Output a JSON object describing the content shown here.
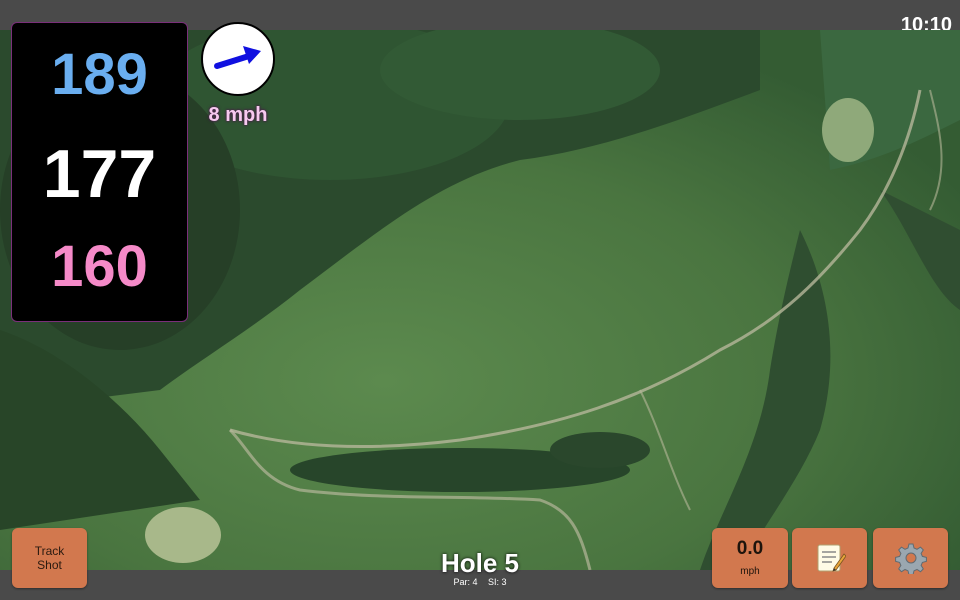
{
  "status_bar": {
    "time": "10:10"
  },
  "distances": {
    "back": "189",
    "middle": "177",
    "front": "160"
  },
  "wind": {
    "speed": "8 mph",
    "direction_icon": "wind-arrow-icon"
  },
  "hole": {
    "title": "Hole 5",
    "par": "Par: 4",
    "stroke_index": "SI: 3"
  },
  "buttons": {
    "track_shot_line1": "Track",
    "track_shot_line2": "Shot",
    "speed_value": "0.0",
    "speed_unit": "mph",
    "notes_icon": "notepad-icon",
    "settings_icon": "gear-icon"
  },
  "colors": {
    "back": "#6aaef0",
    "middle": "#ffffff",
    "front": "#f58ac8",
    "button": "#d2784e",
    "wind_arrow": "#1010e0"
  }
}
